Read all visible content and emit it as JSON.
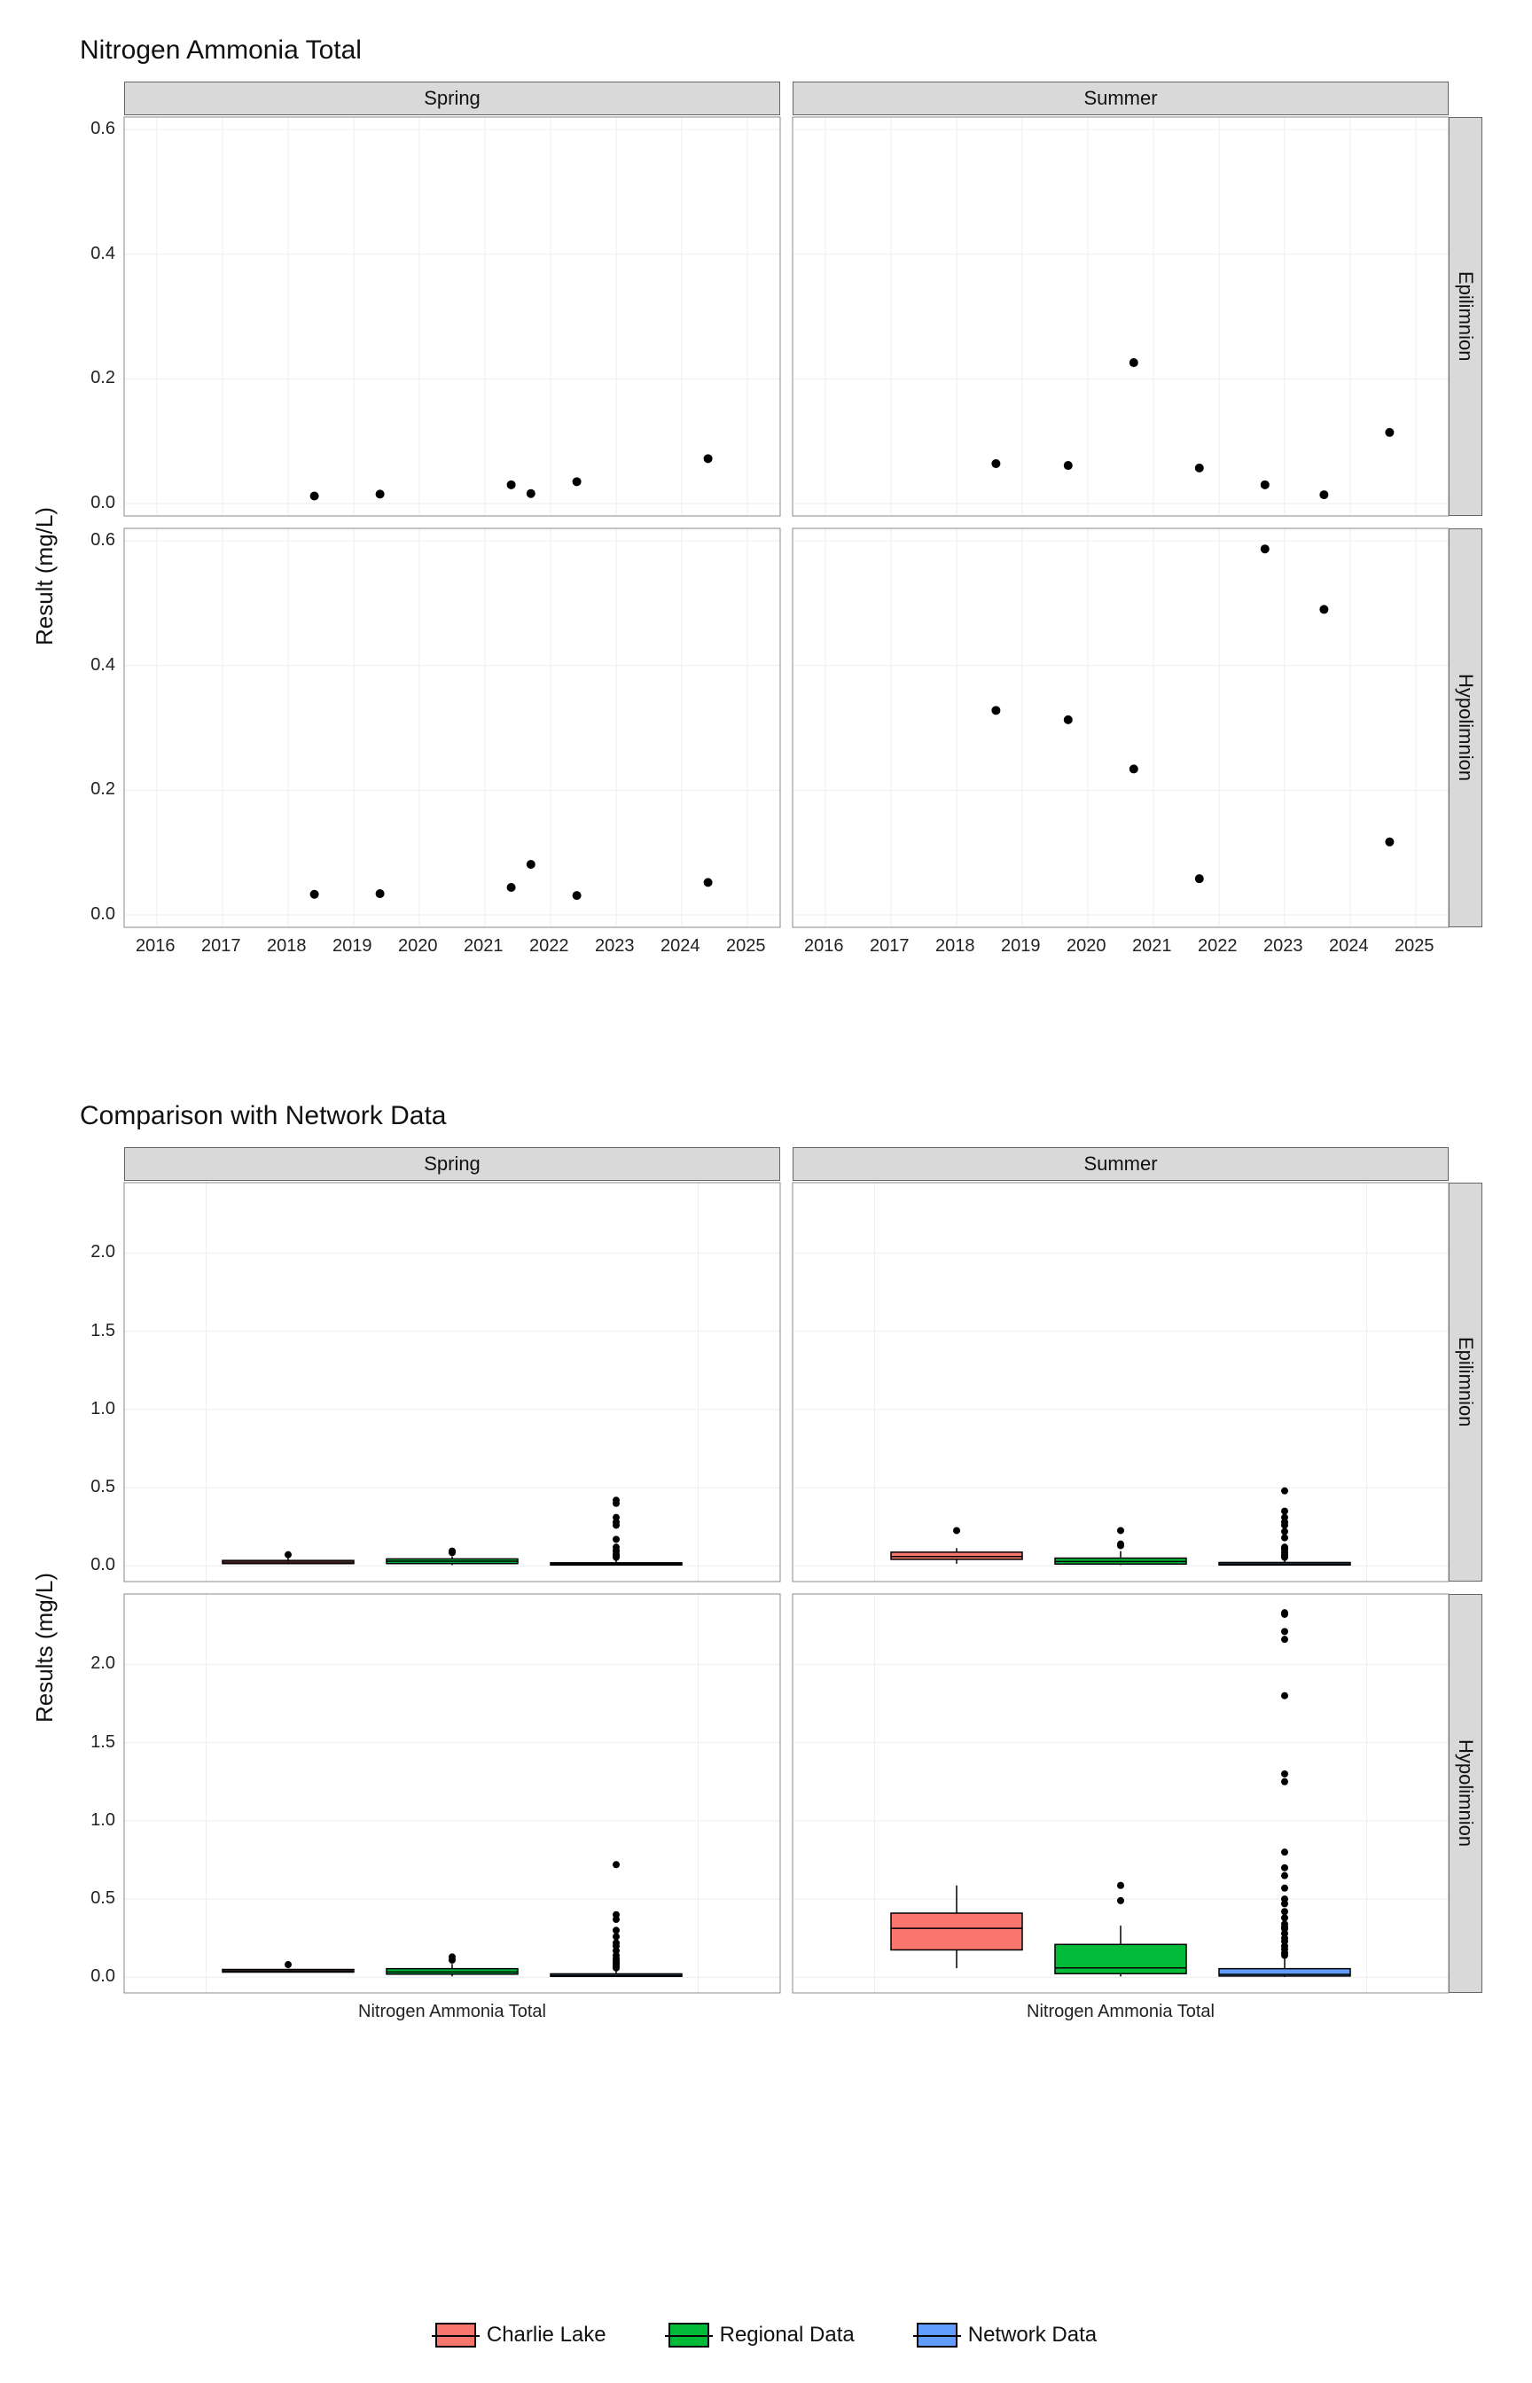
{
  "chart_data": [
    {
      "type": "scatter",
      "title": "Nitrogen Ammonia Total",
      "ylabel": "Result (mg/L)",
      "x_ticks": [
        2016,
        2017,
        2018,
        2019,
        2020,
        2021,
        2022,
        2023,
        2024,
        2025
      ],
      "y_ticks": [
        0.0,
        0.2,
        0.4,
        0.6
      ],
      "xlim": [
        2015.5,
        2025.5
      ],
      "ylim": [
        -0.02,
        0.62
      ],
      "col_labels": [
        "Spring",
        "Summer"
      ],
      "row_labels": [
        "Epilimnion",
        "Hypolimnion"
      ],
      "panels": {
        "spring_epi": [
          {
            "x": 2018.4,
            "y": 0.012
          },
          {
            "x": 2019.4,
            "y": 0.015
          },
          {
            "x": 2021.4,
            "y": 0.03
          },
          {
            "x": 2021.7,
            "y": 0.016
          },
          {
            "x": 2022.4,
            "y": 0.035
          },
          {
            "x": 2024.4,
            "y": 0.072
          }
        ],
        "summer_epi": [
          {
            "x": 2018.6,
            "y": 0.064
          },
          {
            "x": 2019.7,
            "y": 0.061
          },
          {
            "x": 2020.7,
            "y": 0.226
          },
          {
            "x": 2021.7,
            "y": 0.057
          },
          {
            "x": 2022.7,
            "y": 0.03
          },
          {
            "x": 2023.6,
            "y": 0.014
          },
          {
            "x": 2024.6,
            "y": 0.114
          }
        ],
        "spring_hypo": [
          {
            "x": 2018.4,
            "y": 0.033
          },
          {
            "x": 2019.4,
            "y": 0.034
          },
          {
            "x": 2021.4,
            "y": 0.044
          },
          {
            "x": 2021.7,
            "y": 0.081
          },
          {
            "x": 2022.4,
            "y": 0.031
          },
          {
            "x": 2024.4,
            "y": 0.052
          }
        ],
        "summer_hypo": [
          {
            "x": 2018.6,
            "y": 0.328
          },
          {
            "x": 2019.7,
            "y": 0.313
          },
          {
            "x": 2020.7,
            "y": 0.234
          },
          {
            "x": 2021.7,
            "y": 0.058
          },
          {
            "x": 2022.7,
            "y": 0.587
          },
          {
            "x": 2023.6,
            "y": 0.49
          },
          {
            "x": 2024.6,
            "y": 0.117
          }
        ]
      }
    },
    {
      "type": "boxplot",
      "title": "Comparison with Network Data",
      "ylabel": "Results (mg/L)",
      "x_category": "Nitrogen Ammonia Total",
      "y_ticks": [
        0.0,
        0.5,
        1.0,
        1.5,
        2.0
      ],
      "ylim": [
        -0.1,
        2.45
      ],
      "col_labels": [
        "Spring",
        "Summer"
      ],
      "row_labels": [
        "Epilimnion",
        "Hypolimnion"
      ],
      "series": [
        "Charlie Lake",
        "Regional Data",
        "Network Data"
      ],
      "colors": {
        "Charlie Lake": "#F8766D",
        "Regional Data": "#00BA38",
        "Network Data": "#619CFF"
      },
      "panels": {
        "spring_epi": {
          "boxes": [
            {
              "series": "Charlie Lake",
              "min": 0.01,
              "q1": 0.015,
              "med": 0.025,
              "q3": 0.035,
              "max": 0.05,
              "outliers": [
                0.072
              ]
            },
            {
              "series": "Regional Data",
              "min": 0.005,
              "q1": 0.015,
              "med": 0.03,
              "q3": 0.045,
              "max": 0.06,
              "outliers": [
                0.095,
                0.085
              ]
            },
            {
              "series": "Network Data",
              "min": 0.002,
              "q1": 0.006,
              "med": 0.012,
              "q3": 0.02,
              "max": 0.04,
              "outliers": [
                0.26,
                0.28,
                0.31,
                0.4,
                0.42,
                0.17,
                0.12,
                0.1,
                0.095,
                0.075,
                0.065,
                0.055
              ]
            }
          ]
        },
        "summer_epi": {
          "boxes": [
            {
              "series": "Charlie Lake",
              "min": 0.014,
              "q1": 0.042,
              "med": 0.06,
              "q3": 0.088,
              "max": 0.114,
              "outliers": [
                0.226
              ]
            },
            {
              "series": "Regional Data",
              "min": 0.005,
              "q1": 0.012,
              "med": 0.028,
              "q3": 0.05,
              "max": 0.095,
              "outliers": [
                0.226,
                0.14,
                0.13
              ]
            },
            {
              "series": "Network Data",
              "min": 0.002,
              "q1": 0.006,
              "med": 0.012,
              "q3": 0.022,
              "max": 0.05,
              "outliers": [
                0.48,
                0.35,
                0.31,
                0.28,
                0.26,
                0.22,
                0.18,
                0.12,
                0.115,
                0.105,
                0.085,
                0.07,
                0.065,
                0.055
              ]
            }
          ]
        },
        "spring_hypo": {
          "boxes": [
            {
              "series": "Charlie Lake",
              "min": 0.031,
              "q1": 0.033,
              "med": 0.04,
              "q3": 0.05,
              "max": 0.055,
              "outliers": [
                0.081
              ]
            },
            {
              "series": "Regional Data",
              "min": 0.006,
              "q1": 0.02,
              "med": 0.034,
              "q3": 0.055,
              "max": 0.085,
              "outliers": [
                0.13,
                0.11
              ]
            },
            {
              "series": "Network Data",
              "min": 0.002,
              "q1": 0.006,
              "med": 0.012,
              "q3": 0.022,
              "max": 0.05,
              "outliers": [
                0.72,
                0.4,
                0.37,
                0.3,
                0.26,
                0.22,
                0.2,
                0.17,
                0.14,
                0.12,
                0.105,
                0.095,
                0.085,
                0.07,
                0.06
              ]
            }
          ]
        },
        "summer_hypo": {
          "boxes": [
            {
              "series": "Charlie Lake",
              "min": 0.058,
              "q1": 0.175,
              "med": 0.313,
              "q3": 0.41,
              "max": 0.587,
              "outliers": []
            },
            {
              "series": "Regional Data",
              "min": 0.005,
              "q1": 0.023,
              "med": 0.06,
              "q3": 0.21,
              "max": 0.33,
              "outliers": [
                0.587,
                0.49
              ]
            },
            {
              "series": "Network Data",
              "min": 0.002,
              "q1": 0.008,
              "med": 0.018,
              "q3": 0.055,
              "max": 0.12,
              "outliers": [
                2.33,
                2.32,
                2.21,
                2.16,
                1.8,
                1.3,
                1.25,
                0.8,
                0.7,
                0.65,
                0.57,
                0.5,
                0.47,
                0.42,
                0.38,
                0.34,
                0.32,
                0.31,
                0.28,
                0.25,
                0.23,
                0.2,
                0.18,
                0.155,
                0.14
              ]
            }
          ]
        }
      }
    }
  ],
  "legend": {
    "items": [
      "Charlie Lake",
      "Regional Data",
      "Network Data"
    ]
  }
}
